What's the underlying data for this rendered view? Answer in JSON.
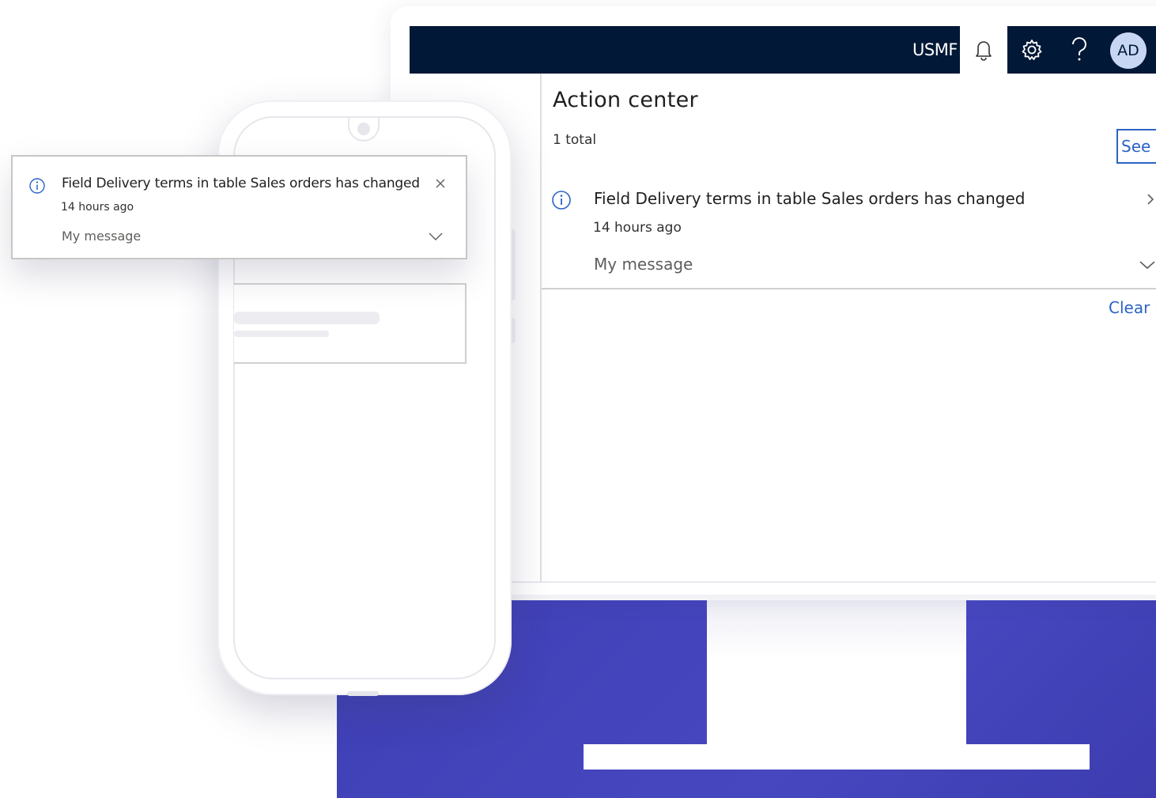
{
  "header": {
    "company": "USMF",
    "avatar_initials": "AD",
    "icons": [
      "bell-icon",
      "gear-icon",
      "help-icon"
    ]
  },
  "action_center": {
    "title": "Action center",
    "total": "1 total",
    "see_all_label": "See all",
    "clear_all_label": "Clear all",
    "notifications": [
      {
        "title": "Field Delivery terms in table Sales orders has changed",
        "time": "14 hours ago",
        "message": "My message"
      }
    ]
  },
  "toast": {
    "title": "Field Delivery terms in table Sales orders has changed",
    "time": "14 hours ago",
    "message": "My message"
  },
  "colors": {
    "topbar": "#011836",
    "accent": "#2b63c5",
    "monitor_stand": "#4343bc",
    "avatar": "#c7d6f3"
  }
}
